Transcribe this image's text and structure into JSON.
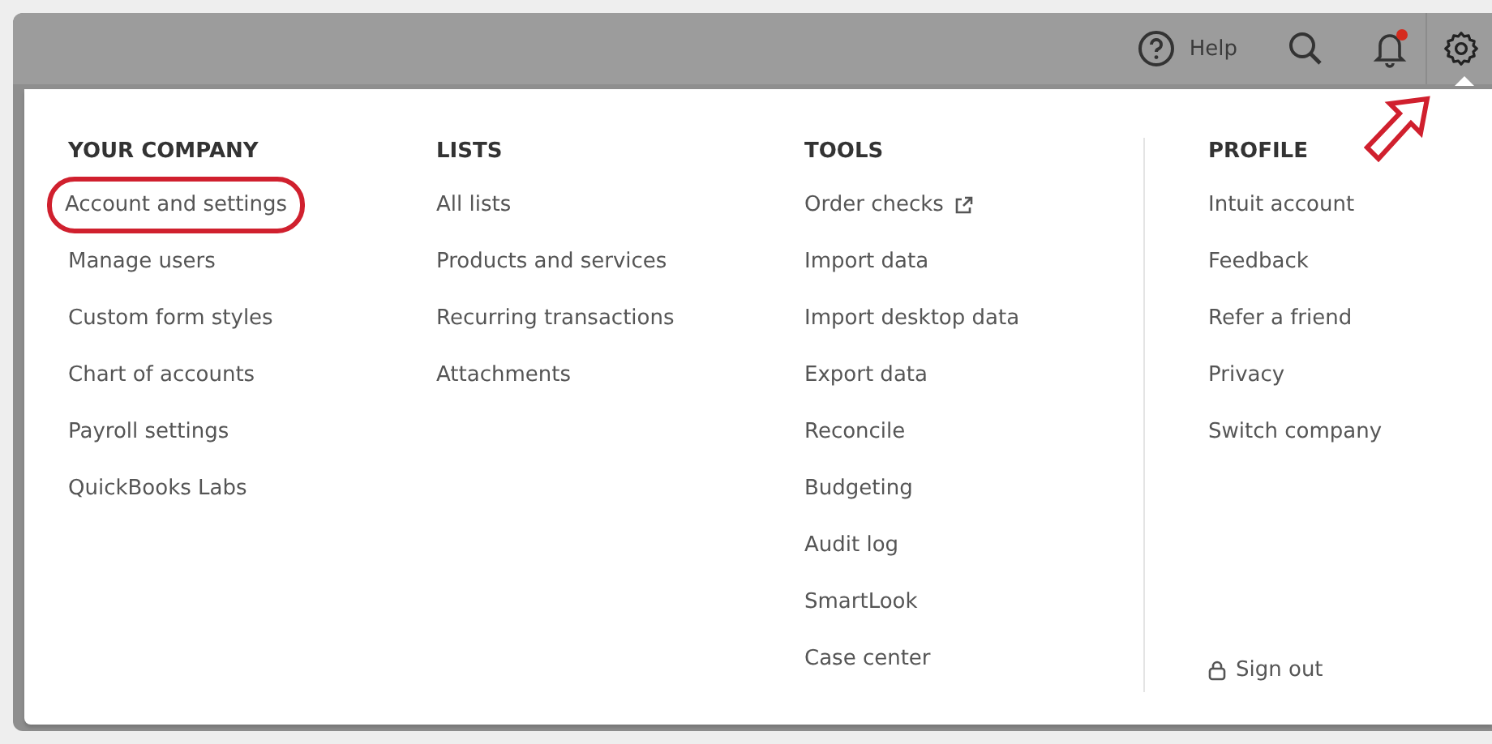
{
  "top_bar": {
    "help_label": "Help",
    "has_notification": true,
    "settings_open": true
  },
  "menu_columns": [
    {
      "heading": "YOUR COMPANY",
      "items": [
        {
          "label": "Account and settings",
          "highlighted": true
        },
        {
          "label": "Manage users",
          "highlighted": false
        },
        {
          "label": "Custom form styles",
          "highlighted": false
        },
        {
          "label": "Chart of accounts",
          "highlighted": false
        },
        {
          "label": "Payroll settings",
          "highlighted": false
        },
        {
          "label": "QuickBooks Labs",
          "highlighted": false
        }
      ]
    },
    {
      "heading": "LISTS",
      "items": [
        {
          "label": "All lists",
          "highlighted": false
        },
        {
          "label": "Products and services",
          "highlighted": false
        },
        {
          "label": "Recurring transactions",
          "highlighted": false
        },
        {
          "label": "Attachments",
          "highlighted": false
        }
      ]
    },
    {
      "heading": "TOOLS",
      "items": [
        {
          "label": "Order checks",
          "highlighted": false,
          "external": true
        },
        {
          "label": "Import data",
          "highlighted": false
        },
        {
          "label": "Import desktop data",
          "highlighted": false
        },
        {
          "label": "Export data",
          "highlighted": false
        },
        {
          "label": "Reconcile",
          "highlighted": false
        },
        {
          "label": "Budgeting",
          "highlighted": false
        },
        {
          "label": "Audit log",
          "highlighted": false
        },
        {
          "label": "SmartLook",
          "highlighted": false
        },
        {
          "label": "Case center",
          "highlighted": false
        }
      ]
    },
    {
      "heading": "PROFILE",
      "items": [
        {
          "label": "Intuit account",
          "highlighted": false
        },
        {
          "label": "Feedback",
          "highlighted": false
        },
        {
          "label": "Refer a friend",
          "highlighted": false
        },
        {
          "label": "Privacy",
          "highlighted": false
        },
        {
          "label": "Switch company",
          "highlighted": false
        }
      ],
      "footer": {
        "label": "Sign out"
      }
    }
  ]
}
